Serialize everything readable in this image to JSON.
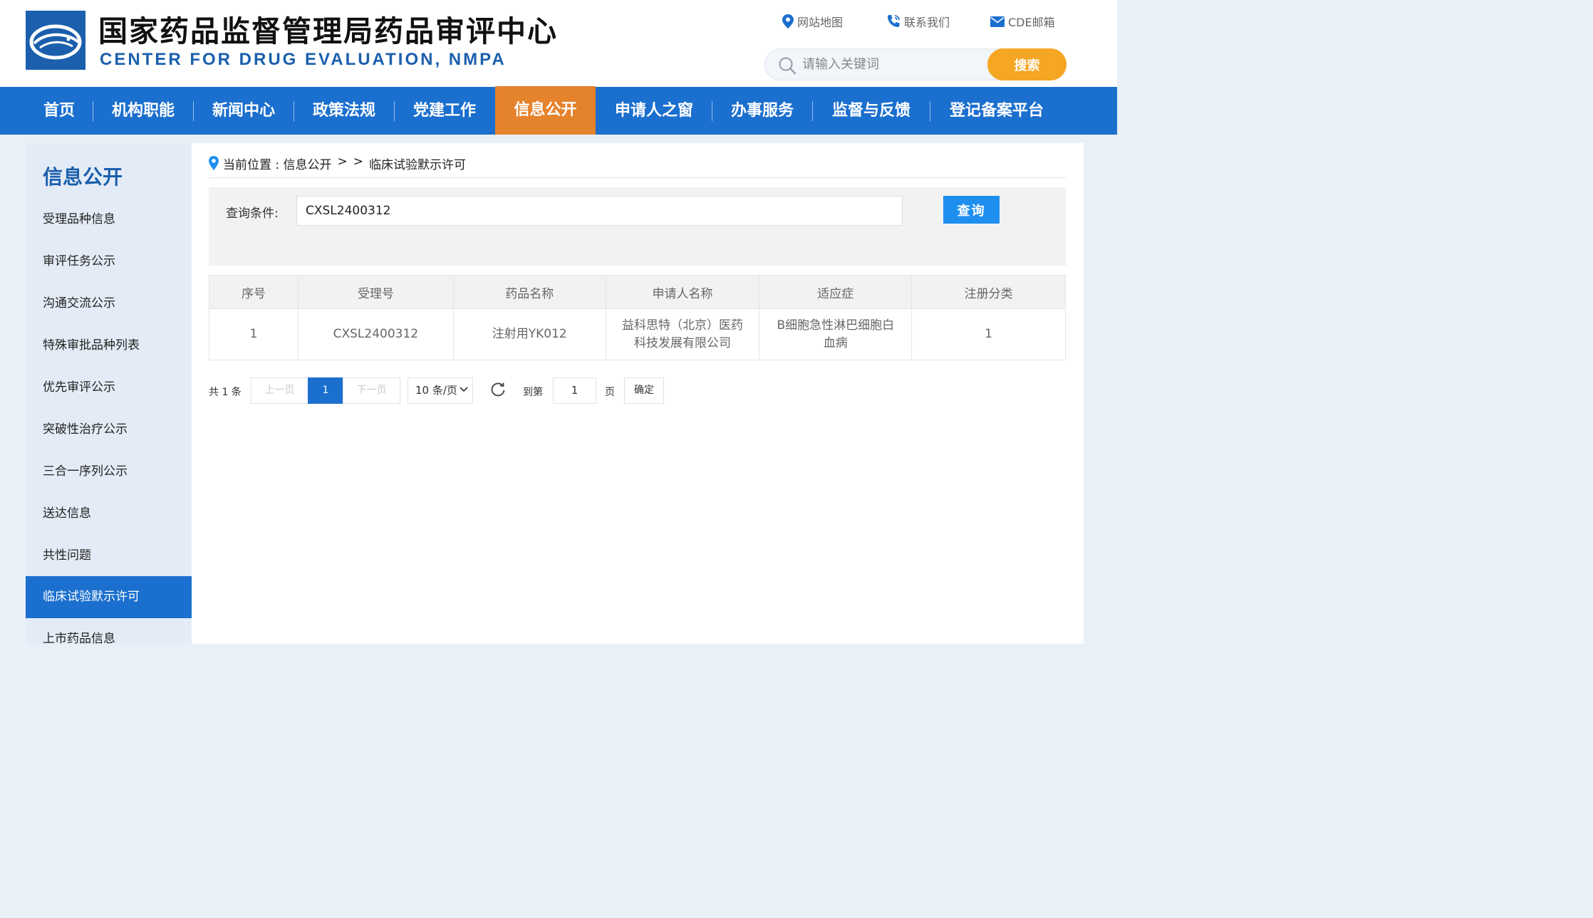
{
  "header": {
    "title_cn": "国家药品监督管理局药品审评中心",
    "title_en": "CENTER FOR DRUG EVALUATION, NMPA",
    "links": [
      {
        "label": "网站地图",
        "icon": "map-pin-icon"
      },
      {
        "label": "联系我们",
        "icon": "phone-icon"
      },
      {
        "label": "CDE邮箱",
        "icon": "mail-icon"
      }
    ],
    "search": {
      "placeholder": "请输入关键词",
      "button": "搜索"
    }
  },
  "nav": {
    "items": [
      "首页",
      "机构职能",
      "新闻中心",
      "政策法规",
      "党建工作",
      "信息公开",
      "申请人之窗",
      "办事服务",
      "监督与反馈",
      "登记备案平台"
    ],
    "active": "信息公开"
  },
  "sidebar": {
    "title": "信息公开",
    "items": [
      "受理品种信息",
      "审评任务公示",
      "沟通交流公示",
      "特殊审批品种列表",
      "优先审评公示",
      "突破性治疗公示",
      "三合一序列公示",
      "送达信息",
      "共性问题",
      "临床试验默示许可",
      "上市药品信息"
    ],
    "active": "临床试验默示许可"
  },
  "breadcrumb": {
    "prefix": "当前位置 : 信息公开",
    "sep1": ">",
    "sep2": ">",
    "current": "临床试验默示许可"
  },
  "query": {
    "label": "查询条件:",
    "value": "CXSL2400312",
    "button": "查询"
  },
  "table": {
    "headers": [
      "序号",
      "受理号",
      "药品名称",
      "申请人名称",
      "适应症",
      "注册分类"
    ],
    "rows": [
      [
        "1",
        "CXSL2400312",
        "注射用YK012",
        "益科思特（北京）医药科技发展有限公司",
        "B细胞急性淋巴细胞白血病",
        "1"
      ]
    ]
  },
  "pagination": {
    "total": "共 1 条",
    "prev": "上一页",
    "current": "1",
    "next": "下一页",
    "page_size": "10 条/页",
    "goto_label": "到第",
    "goto_value": "1",
    "page_unit": "页",
    "confirm": "确定"
  },
  "colors": {
    "brand_blue": "#1b6fce",
    "active_orange": "#e5822c",
    "search_orange": "#f5a623",
    "query_blue": "#1f8fef"
  }
}
